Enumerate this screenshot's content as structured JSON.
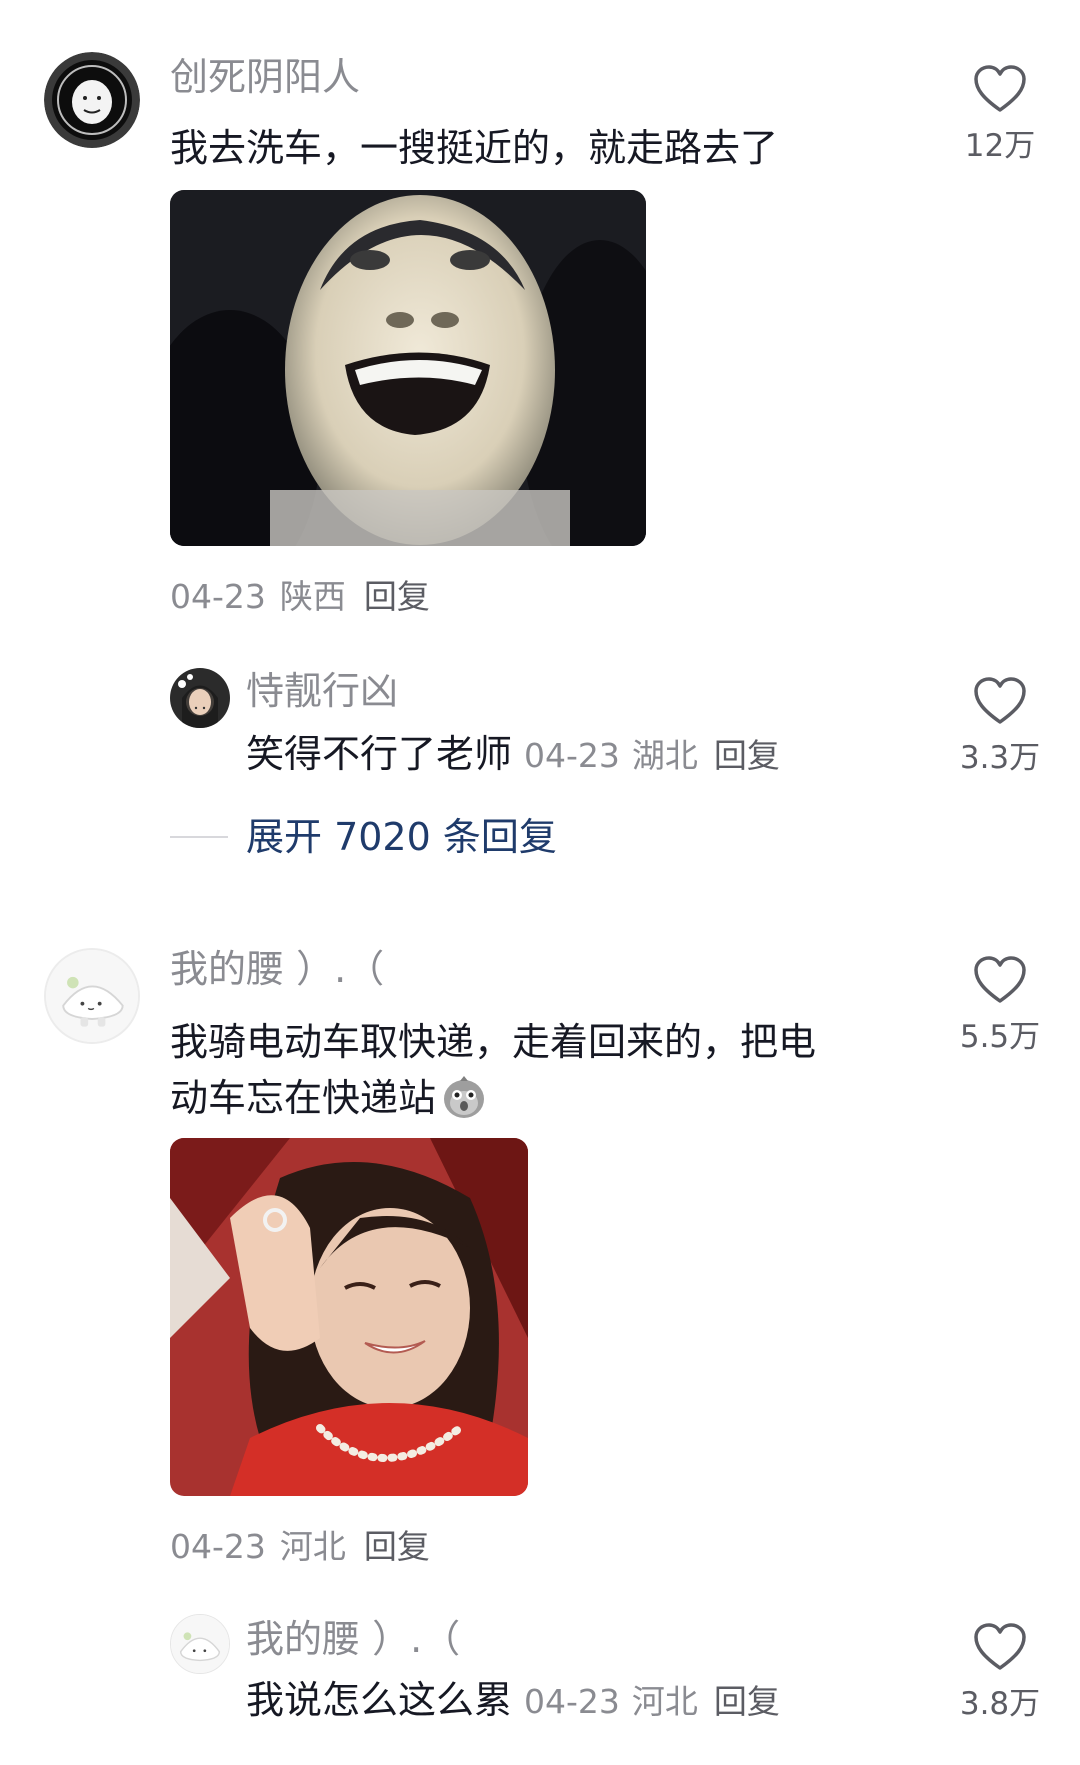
{
  "comments": [
    {
      "username": "创死阴阳人",
      "text": "我去洗车，一搜挺近的，就走路去了",
      "date": "04-23",
      "region": "陕西",
      "reply_label": "回复",
      "likes": "12万",
      "media_icon": "laughing-face-meme-image",
      "avatar_icon": "white-face-avatar",
      "sub_reply": {
        "username": "恃靓行凶",
        "text": "笑得不行了老师",
        "date": "04-23",
        "region": "湖北",
        "reply_label": "回复",
        "likes": "3.3万",
        "avatar_icon": "girl-portrait-avatar"
      },
      "expand_label": "展开 7020 条回复"
    },
    {
      "username": "我的腰 ）.（",
      "text_line1": "我骑电动车取快递，走着回来的，把电",
      "text_line2": "动车忘在快递站",
      "emoji_icon": "shocked-bird-emoji",
      "date": "04-23",
      "region": "河北",
      "reply_label": "回复",
      "likes": "5.5万",
      "media_icon": "smiling-woman-meme-image",
      "avatar_icon": "plush-toy-avatar",
      "sub_reply": {
        "username": "我的腰 ）.（",
        "text": "我说怎么这么累",
        "date": "04-23",
        "region": "河北",
        "reply_label": "回复",
        "likes": "3.8万",
        "avatar_icon": "plush-toy-avatar"
      }
    }
  ],
  "icons": {
    "like": "heart-outline-icon"
  },
  "colors": {
    "text": "#161823",
    "muted": "#8a8b91",
    "link": "#1f3b6b"
  }
}
